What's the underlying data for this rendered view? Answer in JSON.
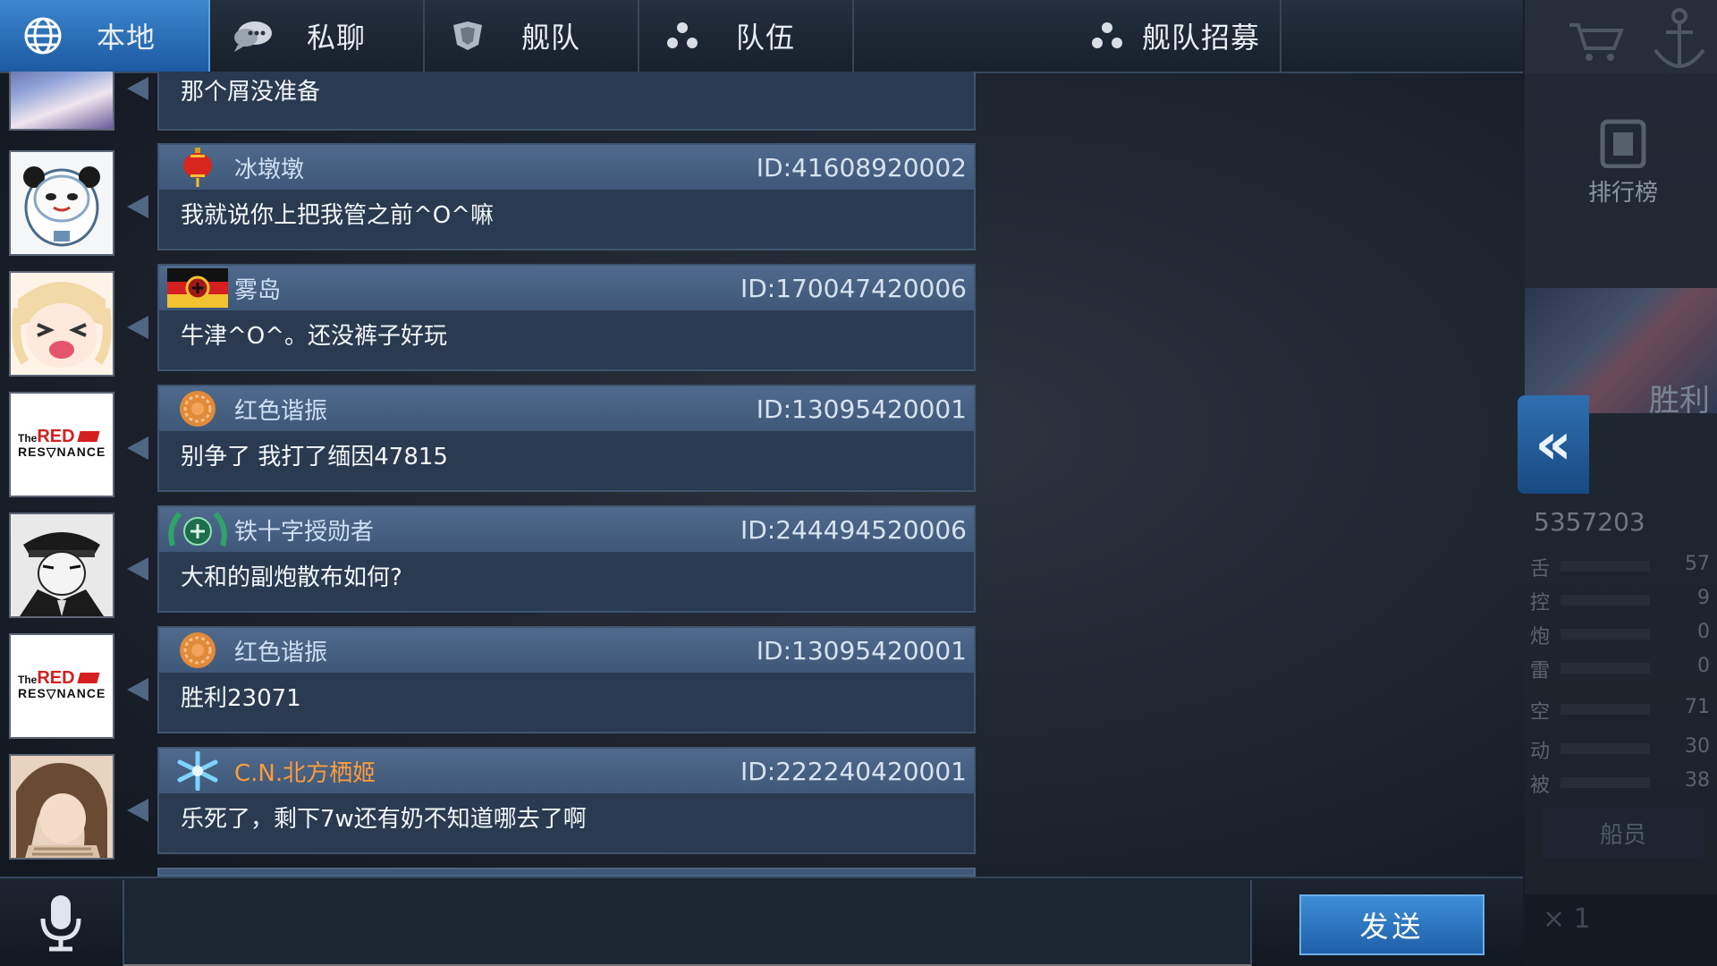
{
  "tabs": [
    {
      "label": "本地",
      "icon": "globe-icon",
      "active": true
    },
    {
      "label": "私聊",
      "icon": "speech-bubble-icon",
      "active": false
    },
    {
      "label": "舰队",
      "icon": "fleet-emblem-icon",
      "active": false
    },
    {
      "label": "队伍",
      "icon": "team-dots-icon",
      "active": false
    }
  ],
  "recruit_tab": {
    "label": "舰队招募",
    "icon": "team-dots-icon"
  },
  "partial_message": {
    "text": "那个屑没准备"
  },
  "messages": [
    {
      "name": "冰墩墩",
      "uid": "ID:41608920002",
      "text": "我就说你上把我管之前^O^嘛",
      "badge": "lantern-badge-icon",
      "avatar": "panda-avatar",
      "name_color": "default"
    },
    {
      "name": "雾岛",
      "uid": "ID:170047420006",
      "text": "牛津^O^。还没裤子好玩",
      "badge": "german-flag-badge-icon",
      "avatar": "anime-girl-crying-avatar",
      "name_color": "default"
    },
    {
      "name": "红色谐振",
      "uid": "ID:13095420001",
      "text": "别争了 我打了缅因47815",
      "badge": "bronze-medal-badge-icon",
      "avatar": "red-resonance-logo-avatar",
      "name_color": "default"
    },
    {
      "name": "铁十字授勋者",
      "uid": "ID:244494520006",
      "text": "大和的副炮散布如何?",
      "badge": "green-wreath-badge-icon",
      "avatar": "officer-manga-avatar",
      "name_color": "default"
    },
    {
      "name": "红色谐振",
      "uid": "ID:13095420001",
      "text": "胜利23071",
      "badge": "bronze-medal-badge-icon",
      "avatar": "red-resonance-logo-avatar",
      "name_color": "default"
    },
    {
      "name": "C.N.北方栖姬",
      "uid": "ID:222240420001",
      "text": "乐死了，剩下7w还有奶不知道哪去了啊",
      "badge": "snowflake-badge-icon",
      "avatar": "brown-hair-girl-avatar",
      "name_color": "orange"
    }
  ],
  "logo_text": {
    "line1_small": "The",
    "line1_big": "RED",
    "line2": "RES▽NANCE"
  },
  "right_panel": {
    "rank_label": "排行榜",
    "victory_label": "胜利",
    "hp_value": "5357203",
    "stats": [
      {
        "k": "舌",
        "v": "57"
      },
      {
        "k": "控",
        "v": "9"
      },
      {
        "k": "炮",
        "v": "0"
      },
      {
        "k": "雷",
        "v": "0"
      },
      {
        "k": "空",
        "v": "71"
      },
      {
        "k": "动",
        "v": "30"
      },
      {
        "k": "被",
        "v": "38"
      }
    ],
    "crew_label": "船员",
    "count_label": "× 1",
    "collapse_glyph": "«"
  },
  "input": {
    "placeholder": "",
    "value": ""
  },
  "send_button": {
    "label": "发送"
  },
  "colors": {
    "accent": "#2f7ac4",
    "bubble": "#2a3a50",
    "bubble_head": "#46607f",
    "orange_name": "#ff9b3a"
  }
}
